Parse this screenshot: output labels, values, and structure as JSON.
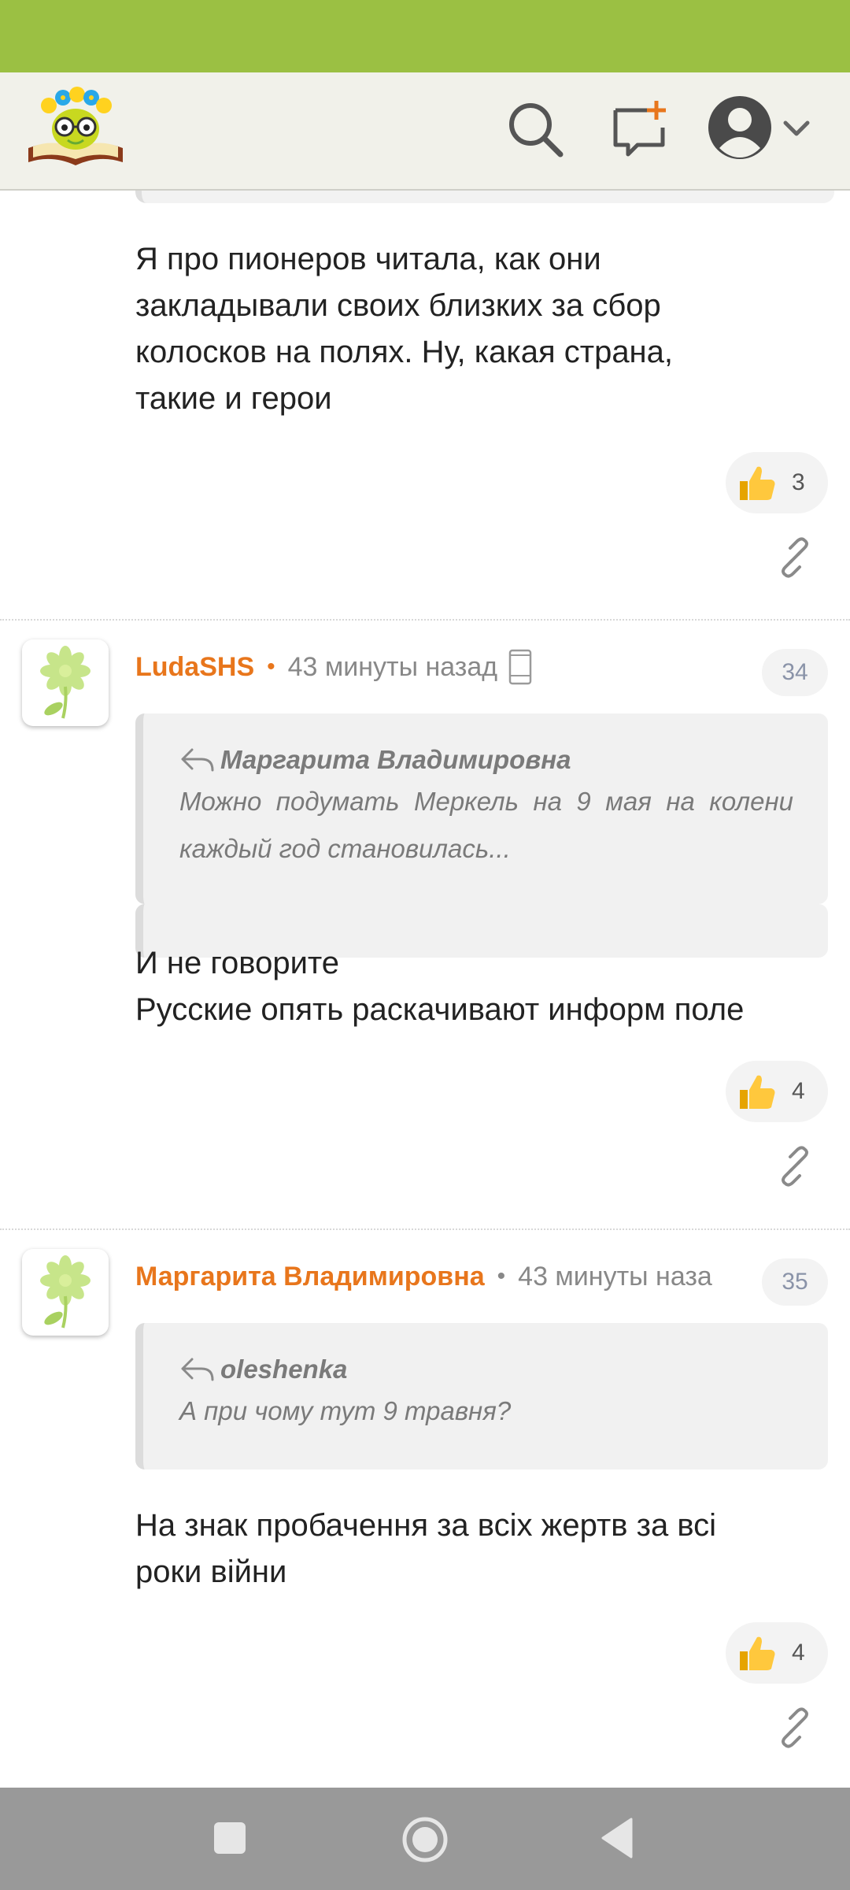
{
  "colors": {
    "status_bar": "#9bc043",
    "accent": "#e8761c",
    "nav_bar": "#999999"
  },
  "header": {
    "logo": "book-worm-logo",
    "icons": [
      "search-icon",
      "new-post-icon",
      "user-avatar-icon",
      "chevron-down-icon"
    ]
  },
  "comments": [
    {
      "body_lines": [
        "Я про пионеров читала, как они",
        "закладывали своих близких за сбор",
        "колосков на полях. Ну, какая страна,",
        "такие и герои"
      ],
      "likes": "3"
    },
    {
      "author": "LudaSHS",
      "time": "43 минуты назад",
      "number": "34",
      "quote_author": "Маргарита Владимировна",
      "quote_text": "Можно подумать Меркель на 9 мая на колени каждый год становилась...",
      "body_lines": [
        "И не говорите",
        "Русские опять раскачивают информ поле"
      ],
      "likes": "4"
    },
    {
      "author": "Маргарита Владимировна",
      "time": "43 минуты наза",
      "number": "35",
      "quote_author": "oleshenka",
      "quote_text": "А при чому тут 9 травня?",
      "body_lines": [
        "На знак пробачення за всіх жертв за всі",
        "роки війни"
      ],
      "likes": "4"
    }
  ],
  "navbar": {
    "icons": [
      "recent-apps-icon",
      "home-icon",
      "back-icon"
    ]
  }
}
